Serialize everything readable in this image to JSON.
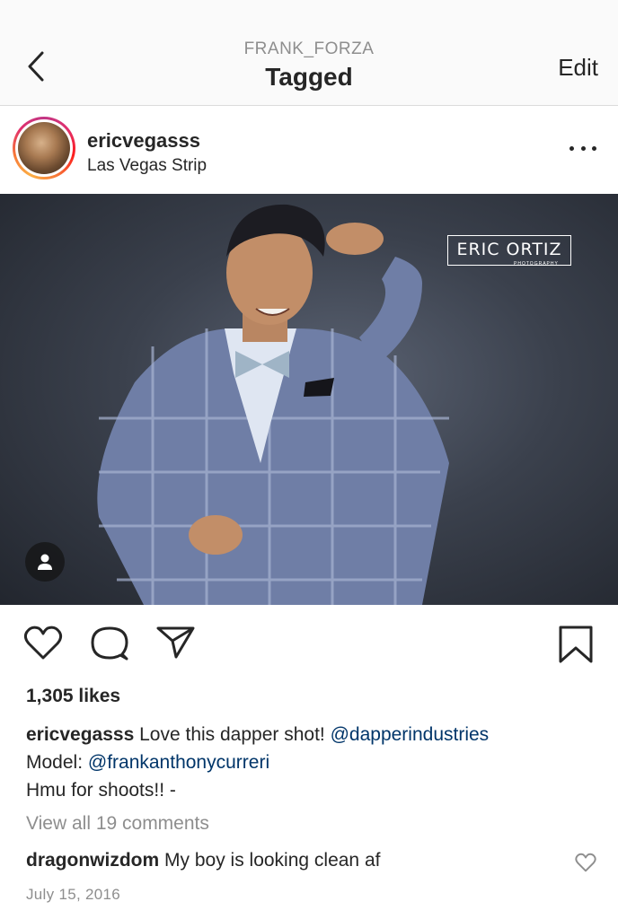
{
  "header": {
    "subtitle": "FRANK_FORZA",
    "title": "Tagged",
    "edit_label": "Edit"
  },
  "post": {
    "username": "ericvegasss",
    "location": "Las Vegas Strip",
    "watermark": "ERIC ORTIZ",
    "watermark_sub": "PHOTOGRAPHY",
    "likes": "1,305 likes",
    "caption": {
      "author": "ericvegasss",
      "text_1": " Love this dapper shot! ",
      "mention_1": "@dapperindustries",
      "text_2": "Model: ",
      "mention_2": "@frankanthonycurreri",
      "text_3": "Hmu for shoots!! -"
    },
    "view_all_comments": "View all 19 comments",
    "comments": [
      {
        "author": "dragonwizdom",
        "text": " My boy is looking clean af"
      }
    ],
    "date": "July 15, 2016"
  },
  "icons": {
    "back": "chevron-left-icon",
    "more": "more-horizontal-icon",
    "tag": "user-tag-icon",
    "like": "heart-icon",
    "comment": "comment-icon",
    "share": "paper-plane-icon",
    "save": "bookmark-icon"
  },
  "colors": {
    "mention": "#003569",
    "muted": "#8e8e8e",
    "text": "#262626"
  }
}
